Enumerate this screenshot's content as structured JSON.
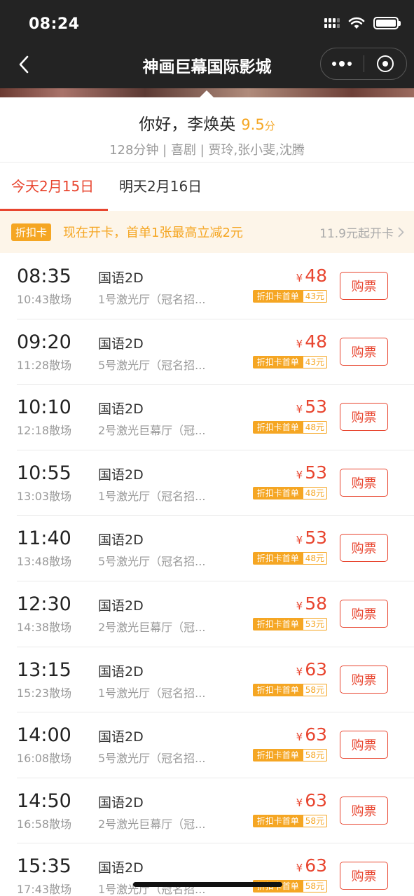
{
  "status_bar": {
    "time": "08:24"
  },
  "nav": {
    "title": "神画巨幕国际影城"
  },
  "movie": {
    "title": "你好，李焕英",
    "score": "9.5",
    "score_unit": "分",
    "meta": "128分钟 | 喜剧 | 贾玲,张小斐,沈腾"
  },
  "tabs": [
    {
      "label": "今天2月15日",
      "active": true
    },
    {
      "label": "明天2月16日",
      "active": false
    }
  ],
  "promo": {
    "badge": "折扣卡",
    "text": "现在开卡，首单1张最高立减2元",
    "right": "11.9元起开卡"
  },
  "currency": "¥",
  "discount_label": "折扣卡首单",
  "buy_label": "购票",
  "showtimes": [
    {
      "start": "08:35",
      "end": "10:43散场",
      "lang": "国语2D",
      "hall": "1号激光厅（冠名招...",
      "price": "48",
      "discount": "43元"
    },
    {
      "start": "09:20",
      "end": "11:28散场",
      "lang": "国语2D",
      "hall": "5号激光厅（冠名招...",
      "price": "48",
      "discount": "43元"
    },
    {
      "start": "10:10",
      "end": "12:18散场",
      "lang": "国语2D",
      "hall": "2号激光巨幕厅（冠...",
      "price": "53",
      "discount": "48元"
    },
    {
      "start": "10:55",
      "end": "13:03散场",
      "lang": "国语2D",
      "hall": "1号激光厅（冠名招...",
      "price": "53",
      "discount": "48元"
    },
    {
      "start": "11:40",
      "end": "13:48散场",
      "lang": "国语2D",
      "hall": "5号激光厅（冠名招...",
      "price": "53",
      "discount": "48元"
    },
    {
      "start": "12:30",
      "end": "14:38散场",
      "lang": "国语2D",
      "hall": "2号激光巨幕厅（冠...",
      "price": "58",
      "discount": "53元"
    },
    {
      "start": "13:15",
      "end": "15:23散场",
      "lang": "国语2D",
      "hall": "1号激光厅（冠名招...",
      "price": "63",
      "discount": "58元"
    },
    {
      "start": "14:00",
      "end": "16:08散场",
      "lang": "国语2D",
      "hall": "5号激光厅（冠名招...",
      "price": "63",
      "discount": "58元"
    },
    {
      "start": "14:50",
      "end": "16:58散场",
      "lang": "国语2D",
      "hall": "2号激光巨幕厅（冠...",
      "price": "63",
      "discount": "58元"
    },
    {
      "start": "15:35",
      "end": "17:43散场",
      "lang": "国语2D",
      "hall": "1号激光厅（冠名招...",
      "price": "63",
      "discount": "58元"
    }
  ],
  "colors": {
    "accent": "#e8452f",
    "discount": "#f5a623",
    "header": "#232323"
  }
}
